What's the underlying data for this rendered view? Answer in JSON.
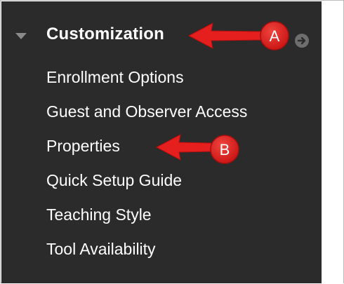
{
  "sidebar": {
    "section_title": "Customization",
    "items": [
      {
        "label": "Enrollment Options"
      },
      {
        "label": "Guest and Observer Access"
      },
      {
        "label": "Properties"
      },
      {
        "label": "Quick Setup Guide"
      },
      {
        "label": "Teaching Style"
      },
      {
        "label": "Tool Availability"
      }
    ]
  },
  "annotations": {
    "a_label": "A",
    "b_label": "B"
  },
  "colors": {
    "sidebar_bg": "#2b2b2b",
    "annotation_red": "#e51e1e"
  },
  "icons": {
    "collapse": "triangle-down-icon",
    "go": "circle-arrow-right-icon"
  }
}
